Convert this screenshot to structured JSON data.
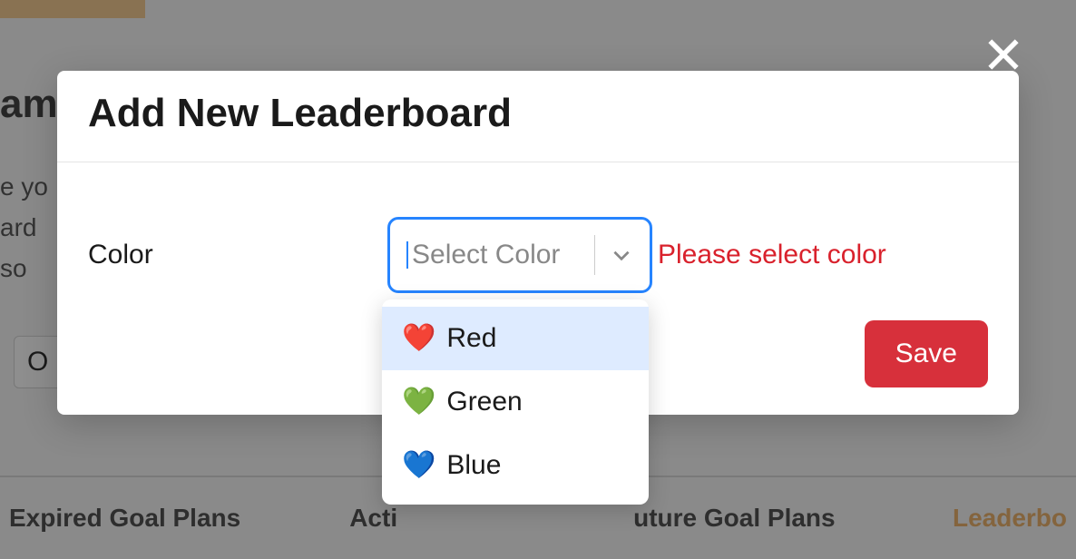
{
  "background": {
    "heading_fragment": "am",
    "line1": "e yo",
    "line2": "ard",
    "line3": "so",
    "input_fragment": "O",
    "tabs": {
      "expired": "Expired Goal Plans",
      "active_fragment": "Acti",
      "future_fragment": "uture Goal Plans",
      "leaderboard_fragment": "Leaderbo"
    }
  },
  "modal": {
    "title": "Add New Leaderboard",
    "form": {
      "color_label": "Color",
      "select_placeholder": "Select Color",
      "error_message": "Please select color"
    },
    "save_button": "Save",
    "dropdown": {
      "options": [
        {
          "emoji": "❤️",
          "label": "Red"
        },
        {
          "emoji": "💚",
          "label": "Green"
        },
        {
          "emoji": "💙",
          "label": "Blue"
        }
      ]
    }
  }
}
